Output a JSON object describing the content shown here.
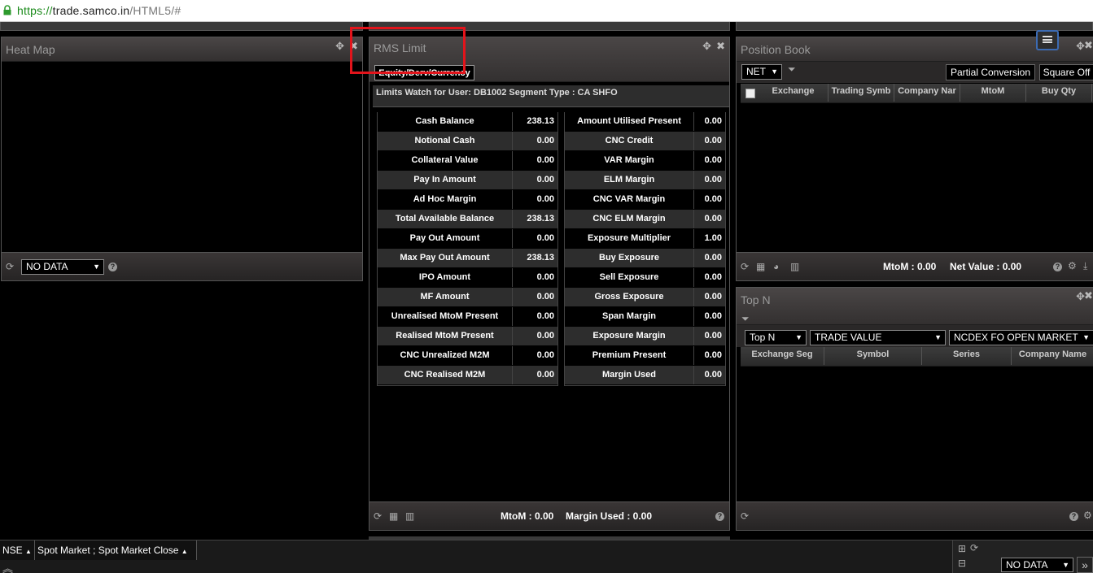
{
  "browser": {
    "url_scheme": "https://",
    "url_host": "trade.samco.in",
    "url_path": "/HTML5/#"
  },
  "heat_map": {
    "title": "Heat Map",
    "dropdown": "NO DATA"
  },
  "rms": {
    "title": "RMS Limit",
    "segment_tab": "Equity/Derv/Currency",
    "info": "Limits Watch for User: DB1002 Segment Type : CA SHFO",
    "left": [
      {
        "label": "Cash Balance",
        "value": "238.13"
      },
      {
        "label": "Notional Cash",
        "value": "0.00"
      },
      {
        "label": "Collateral Value",
        "value": "0.00"
      },
      {
        "label": "Pay In Amount",
        "value": "0.00"
      },
      {
        "label": "Ad Hoc Margin",
        "value": "0.00"
      },
      {
        "label": "Total Available Balance",
        "value": "238.13"
      },
      {
        "label": "Pay Out Amount",
        "value": "0.00"
      },
      {
        "label": "Max Pay Out Amount",
        "value": "238.13"
      },
      {
        "label": "IPO Amount",
        "value": "0.00"
      },
      {
        "label": "MF Amount",
        "value": "0.00"
      },
      {
        "label": "Unrealised MtoM Present",
        "value": "0.00"
      },
      {
        "label": "Realised MtoM Present",
        "value": "0.00"
      },
      {
        "label": "CNC Unrealized M2M",
        "value": "0.00"
      },
      {
        "label": "CNC Realised M2M",
        "value": "0.00"
      }
    ],
    "right": [
      {
        "label": "Amount Utilised Present",
        "value": "0.00"
      },
      {
        "label": "CNC Credit",
        "value": "0.00"
      },
      {
        "label": "VAR Margin",
        "value": "0.00"
      },
      {
        "label": "ELM Margin",
        "value": "0.00"
      },
      {
        "label": "CNC VAR Margin",
        "value": "0.00"
      },
      {
        "label": "CNC ELM Margin",
        "value": "0.00"
      },
      {
        "label": "Exposure Multiplier",
        "value": "1.00"
      },
      {
        "label": "Buy Exposure",
        "value": "0.00"
      },
      {
        "label": "Sell Exposure",
        "value": "0.00"
      },
      {
        "label": "Gross Exposure",
        "value": "0.00"
      },
      {
        "label": "Span Margin",
        "value": "0.00"
      },
      {
        "label": "Exposure Margin",
        "value": "0.00"
      },
      {
        "label": "Premium Present",
        "value": "0.00"
      },
      {
        "label": "Margin Used",
        "value": "0.00"
      }
    ],
    "footer_mtom": "MtoM : 0.00",
    "footer_margin_used": "Margin Used : 0.00"
  },
  "position_book": {
    "title": "Position Book",
    "net_select": "NET",
    "partial_conversion": "Partial Conversion",
    "square_off": "Square Off",
    "columns": [
      "Exchange",
      "Trading Symb",
      "Company Nar",
      "MtoM",
      "Buy Qty"
    ],
    "footer_mtom": "MtoM : 0.00",
    "footer_net_value": "Net Value : 0.00"
  },
  "top_n": {
    "title": "Top N",
    "select_type": "Top N",
    "select_metric": "TRADE VALUE",
    "select_market": "NCDEX FO OPEN MARKET",
    "columns": [
      "Exchange Seg",
      "Symbol",
      "Series",
      "Company Name"
    ]
  },
  "status_bar": {
    "exchange": "NSE",
    "market": "Spot Market ; Spot Market Close",
    "right_dropdown": "NO DATA"
  }
}
